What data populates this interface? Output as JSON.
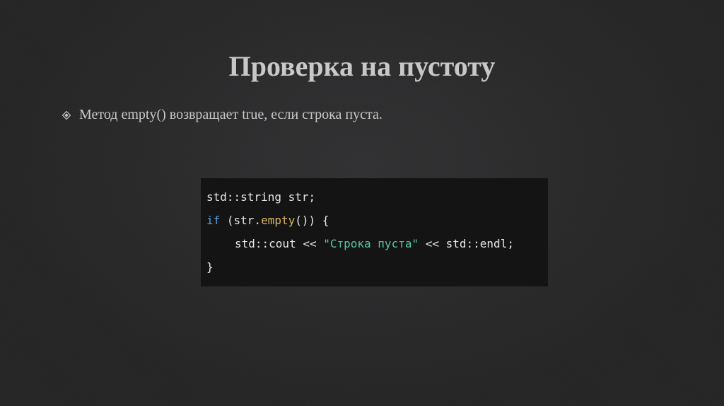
{
  "slide": {
    "title": "Проверка на пустоту",
    "bullet_icon": "diamond-bullet-icon",
    "bullet_text": "Метод empty() возвращает true, если строка пуста."
  },
  "code": {
    "line1": "std::string str;",
    "line2_kw": "if",
    "line2_a": " (str.",
    "line2_fn": "empty",
    "line2_b": "()) {",
    "line3_a": "std::cout << ",
    "line3_str": "\"Строка пуста\"",
    "line3_b": " << std::endl;",
    "line4": "}"
  },
  "colors": {
    "background": "#262627",
    "text": "#c8c8c8",
    "code_bg": "#141414",
    "keyword": "#569cd6",
    "function": "#dcb75f",
    "string": "#57c69c"
  }
}
